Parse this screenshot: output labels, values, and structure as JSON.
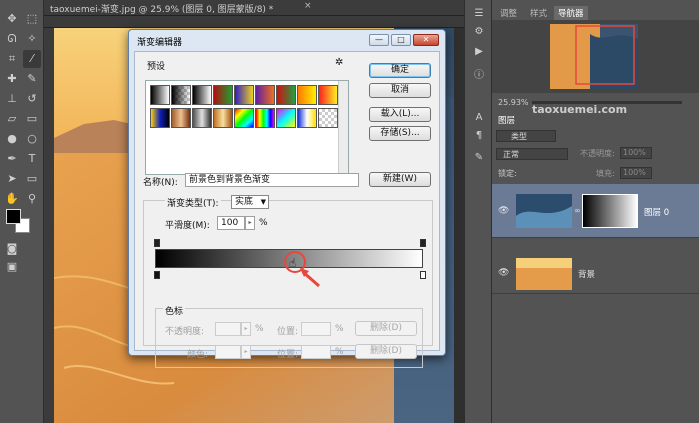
{
  "document": {
    "tab_title": "taoxuemei-渐变.jpg @ 25.9% (图层 0, 图层蒙版/8) *",
    "tab_close": "×"
  },
  "dialog": {
    "title": "渐变编辑器",
    "presets_label": "预设",
    "settings_glyph": "✲",
    "ok_label": "确定",
    "cancel_label": "取消",
    "load_label": "载入(L)...",
    "save_label": "存储(S)...",
    "name_label": "名称(N):",
    "name_value": "前景色到背景色渐变",
    "new_label": "新建(W)",
    "type_label": "渐变类型(T):",
    "type_value": "实底",
    "smooth_label": "平滑度(M):",
    "smooth_value": "100",
    "smooth_unit": "%",
    "stops_group_label": "色标",
    "opacity_label": "不透明度:",
    "opacity_unit": "%",
    "location_label": "位置:",
    "location_unit": "%",
    "delete_label": "删除(D)",
    "color_label": "颜色:",
    "location2_label": "位置:",
    "location2_unit": "%",
    "delete2_label": "删除(D)",
    "gradient": {
      "from": "#000000",
      "to": "#ffffff"
    },
    "win_minimize": "—",
    "win_maximize": "□",
    "win_close": "✕"
  },
  "right_panel": {
    "tabs": [
      "调整",
      "样式",
      "导航器"
    ],
    "active_tab": "导航器",
    "zoom": "25.93%",
    "layers_tab": "图层",
    "kind_label": "类型",
    "blend_mode": "正常",
    "opacity_label": "不透明度:",
    "opacity_value": "100%",
    "lock_label": "锁定:",
    "fill_label": "填充:",
    "fill_value": "100%",
    "layers": [
      {
        "name": "图层 0",
        "visible": true,
        "selected": true
      },
      {
        "name": "背景",
        "visible": true,
        "selected": false
      }
    ]
  },
  "watermark": "taoxuemei.com",
  "colors": {
    "accent_red": "#e8473c",
    "dialog_frame": "#dce7f3",
    "selected_layer": "#6b7b96"
  }
}
